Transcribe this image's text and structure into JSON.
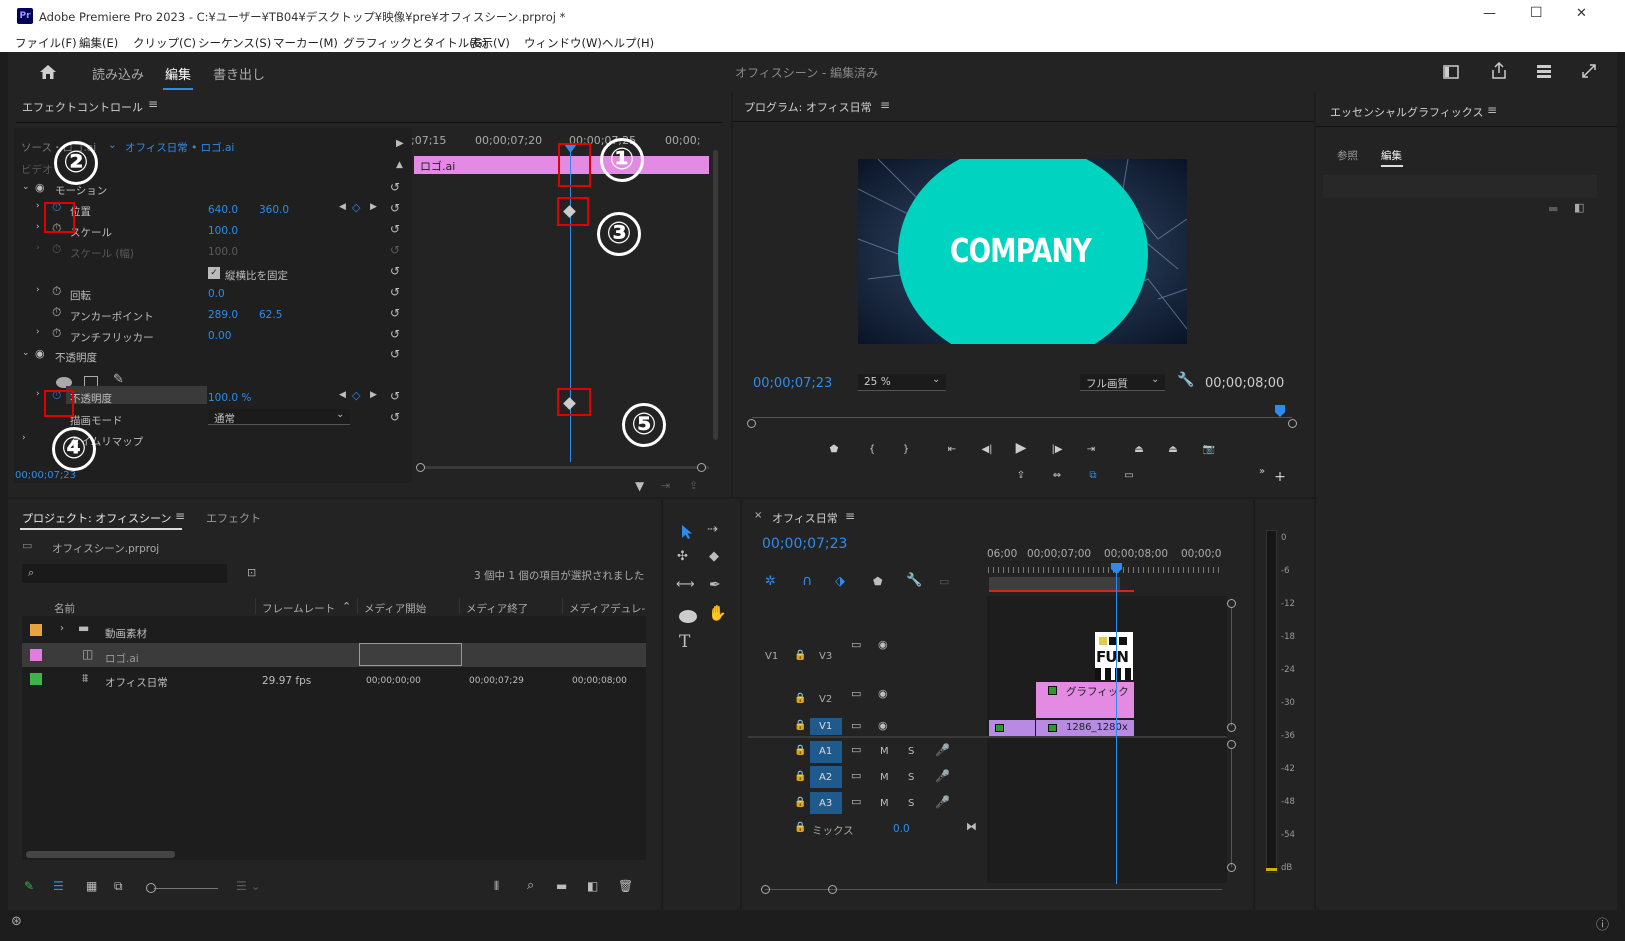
{
  "app": {
    "title": "Adobe Premiere Pro 2023 - C:¥ユーザー¥TB04¥デスクトップ¥映像¥pre¥オフィスシーン.prproj *",
    "logo": "Pr",
    "minimize": "—",
    "maximize": "☐",
    "close": "✕"
  },
  "menu": [
    "ファイル(F)",
    "編集(E)",
    "クリップ(C)",
    "シーケンス(S)",
    "マーカー(M)",
    "グラフィックとタイトル(G)",
    "表示(V)",
    "ウィンドウ(W)",
    "ヘルプ(H)"
  ],
  "workspace": {
    "tabs": [
      "読み込み",
      "編集",
      "書き出し"
    ],
    "active": "編集",
    "center_title": "オフィスシーン - 編集済み"
  },
  "effect_controls": {
    "title": "エフェクトコントロール",
    "source": "ソース・ロゴ.ai",
    "sequence": "オフィス日常 • ロゴ.ai",
    "section_video": "ビデオ",
    "times": [
      ";07;15",
      "00;00;07;20",
      "00;00;07;25",
      "00;00;"
    ],
    "clip_name": "ロゴ.ai",
    "motion": "モーション",
    "position_label": "位置",
    "position_x": "640.0",
    "position_y": "360.0",
    "scale_label": "スケール",
    "scale_val": "100.0",
    "scale_w_label": "スケール (幅)",
    "scale_w_val": "100.0",
    "uniform_label": "縦横比を固定",
    "rotation_label": "回転",
    "rotation_val": "0.0",
    "anchor_label": "アンカーポイント",
    "anchor_x": "289.0",
    "anchor_y": "62.5",
    "flicker_label": "アンチフリッカー",
    "flicker_val": "0.00",
    "opacity_section": "不透明度",
    "opacity_label": "不透明度",
    "opacity_val": "100.0 %",
    "blend_label": "描画モード",
    "blend_val": "通常",
    "timemap": "タイムリマップ",
    "current_time": "00;00;07;23"
  },
  "annotations": [
    "①",
    "②",
    "③",
    "④",
    "⑤"
  ],
  "program": {
    "title": "プログラム: オフィス日常",
    "overlay_text": "COMPANY",
    "timecode": "00;00;07;23",
    "zoom": "25 %",
    "quality": "フル画質",
    "duration": "00;00;08;00"
  },
  "essential_graphics": {
    "title": "エッセンシャルグラフィックス",
    "tabs": [
      "参照",
      "編集"
    ],
    "active": "編集"
  },
  "project": {
    "title": "プロジェクト: オフィスシーン",
    "tab2": "エフェクト",
    "file": "オフィスシーン.prproj",
    "selection_info": "3 個中 1 個の項目が選択されました",
    "columns": [
      "名前",
      "フレームレート",
      "メディア開始",
      "メディア終了",
      "メディアデュレ-"
    ],
    "rows": [
      {
        "color": "#e8a33d",
        "name": "動画素材",
        "fps": "",
        "start": "",
        "end": "",
        "dur": ""
      },
      {
        "color": "#e07ee0",
        "name": "ロゴ.ai",
        "fps": "",
        "start": "",
        "end": "",
        "dur": ""
      },
      {
        "color": "#3db34a",
        "name": "オフィス日常",
        "fps": "29.97 fps",
        "start": "00;00;00;00",
        "end": "00;00;07;29",
        "dur": "00;00;08;00"
      }
    ]
  },
  "timeline": {
    "title": "オフィス日常",
    "timecode": "00;00;07;23",
    "ruler": [
      "06;00",
      "00;00;07;00",
      "00;00;08;00",
      "00;00;0"
    ],
    "tracks_video": [
      {
        "name": "V3",
        "src": "V1"
      },
      {
        "name": "V2",
        "src": ""
      },
      {
        "name": "V1",
        "src": ""
      }
    ],
    "tracks_audio": [
      "A1",
      "A2",
      "A3"
    ],
    "mute": "M",
    "solo": "S",
    "mix_label": "ミックス",
    "mix_val": "0.0",
    "clip_v3": "FUN",
    "clip_v2": "グラフィック",
    "clip_v1": "1286_1280x"
  },
  "meter": {
    "labels": [
      "0",
      "-6",
      "-12",
      "-18",
      "-24",
      "-30",
      "-36",
      "-42",
      "-48",
      "-54",
      "dB"
    ]
  }
}
